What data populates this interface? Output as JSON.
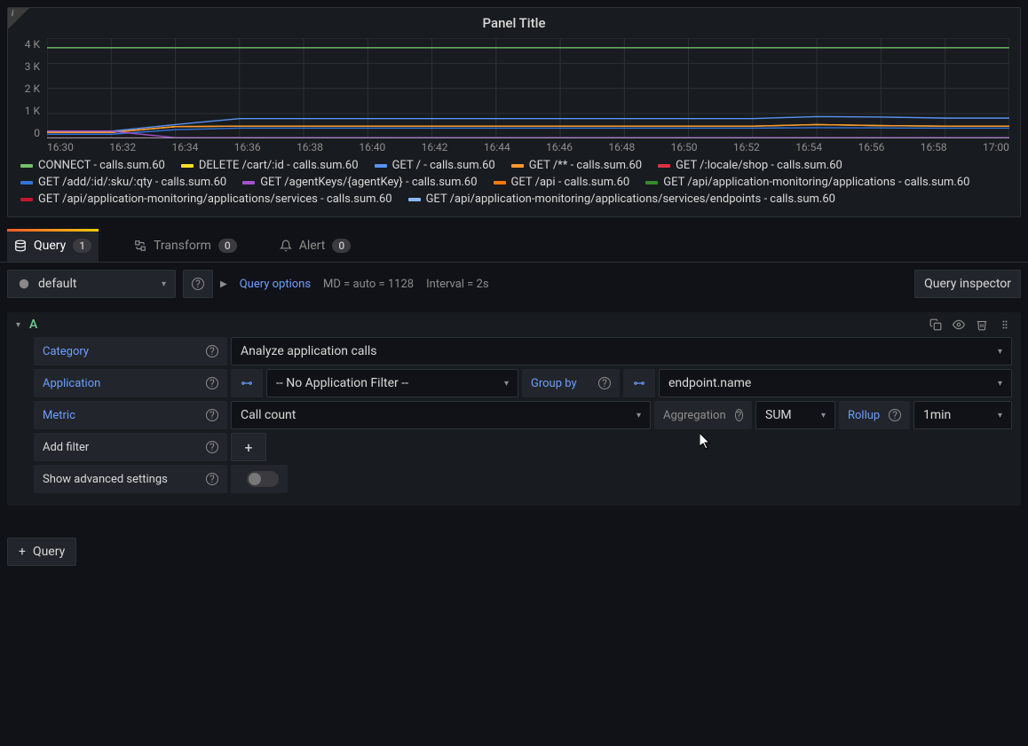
{
  "panel": {
    "title": "Panel Title"
  },
  "chart_data": {
    "type": "line",
    "title": "Panel Title",
    "xlabel": "",
    "ylabel": "",
    "ylim": [
      0,
      4000
    ],
    "y_ticks": [
      "0",
      "1 K",
      "2 K",
      "3 K",
      "4 K"
    ],
    "x_ticks": [
      "16:30",
      "16:32",
      "16:34",
      "16:36",
      "16:38",
      "16:40",
      "16:42",
      "16:44",
      "16:46",
      "16:48",
      "16:50",
      "16:52",
      "16:54",
      "16:56",
      "16:58",
      "17:00"
    ],
    "x": [
      "16:30",
      "16:32",
      "16:34",
      "16:36",
      "16:38",
      "16:40",
      "16:42",
      "16:44",
      "16:46",
      "16:48",
      "16:50",
      "16:52",
      "16:54",
      "16:56",
      "16:58",
      "17:00"
    ],
    "series": [
      {
        "name": "CONNECT - calls.sum.60",
        "color": "#73BF69",
        "values": [
          3620,
          3620,
          3620,
          3620,
          3620,
          3620,
          3620,
          3620,
          3620,
          3620,
          3620,
          3620,
          3620,
          3620,
          3620,
          3620
        ]
      },
      {
        "name": "DELETE /cart/:id - calls.sum.60",
        "color": "#FADE2A",
        "values": [
          250,
          250,
          480,
          500,
          500,
          500,
          500,
          500,
          500,
          500,
          500,
          500,
          560,
          520,
          500,
          500
        ]
      },
      {
        "name": "GET / - calls.sum.60",
        "color": "#5794F2",
        "values": [
          300,
          300,
          560,
          800,
          800,
          800,
          800,
          800,
          800,
          800,
          800,
          800,
          880,
          860,
          820,
          820
        ]
      },
      {
        "name": "GET /** - calls.sum.60",
        "color": "#FF9830",
        "values": [
          250,
          250,
          480,
          500,
          500,
          500,
          500,
          500,
          500,
          500,
          500,
          500,
          560,
          520,
          500,
          500
        ]
      },
      {
        "name": "GET /:locale/shop - calls.sum.60",
        "color": "#E02F44",
        "values": [
          30,
          30,
          30,
          30,
          30,
          30,
          30,
          30,
          30,
          30,
          30,
          30,
          30,
          30,
          30,
          30
        ]
      },
      {
        "name": "GET /add/:id/:sku/:qty - calls.sum.60",
        "color": "#3274D9",
        "values": [
          180,
          180,
          360,
          420,
          420,
          420,
          420,
          420,
          420,
          420,
          420,
          420,
          440,
          430,
          420,
          420
        ]
      },
      {
        "name": "GET /agentKeys/{agentKey} - calls.sum.60",
        "color": "#A352CC",
        "values": [
          300,
          300,
          40,
          40,
          40,
          40,
          40,
          40,
          40,
          40,
          40,
          40,
          40,
          40,
          40,
          40
        ]
      },
      {
        "name": "GET /api - calls.sum.60",
        "color": "#FF780A",
        "values": [
          20,
          20,
          20,
          20,
          20,
          20,
          20,
          20,
          20,
          20,
          20,
          20,
          20,
          20,
          20,
          20
        ]
      },
      {
        "name": "GET /api/application-monitoring/applications - calls.sum.60",
        "color": "#37872D",
        "values": [
          10,
          10,
          10,
          10,
          10,
          10,
          10,
          10,
          10,
          10,
          10,
          10,
          10,
          10,
          10,
          10
        ]
      },
      {
        "name": "GET /api/application-monitoring/applications/services - calls.sum.60",
        "color": "#C4162A",
        "values": [
          10,
          10,
          10,
          10,
          10,
          10,
          10,
          10,
          10,
          10,
          10,
          10,
          10,
          10,
          10,
          10
        ]
      },
      {
        "name": "GET /api/application-monitoring/applications/services/endpoints - calls.sum.60",
        "color": "#8AB8FF",
        "values": [
          10,
          10,
          10,
          10,
          10,
          10,
          10,
          10,
          10,
          10,
          10,
          10,
          10,
          10,
          10,
          10
        ]
      }
    ]
  },
  "tabs": {
    "query": {
      "label": "Query",
      "count": "1"
    },
    "transform": {
      "label": "Transform",
      "count": "0"
    },
    "alert": {
      "label": "Alert",
      "count": "0"
    }
  },
  "toolbar": {
    "datasource": "default",
    "query_options": "Query options",
    "md_info": "MD = auto = 1128",
    "interval": "Interval = 2s",
    "inspector": "Query inspector"
  },
  "query": {
    "letter": "A",
    "labels": {
      "category": "Category",
      "application": "Application",
      "metric": "Metric",
      "add_filter": "Add filter",
      "show_advanced": "Show advanced settings",
      "group_by": "Group by",
      "aggregation": "Aggregation",
      "rollup": "Rollup"
    },
    "values": {
      "category": "Analyze application calls",
      "application": "-- No Application Filter --",
      "groupby": "endpoint.name",
      "metric": "Call count",
      "aggregation": "SUM",
      "rollup": "1min"
    }
  },
  "buttons": {
    "add_query": "Query",
    "plus": "+"
  }
}
